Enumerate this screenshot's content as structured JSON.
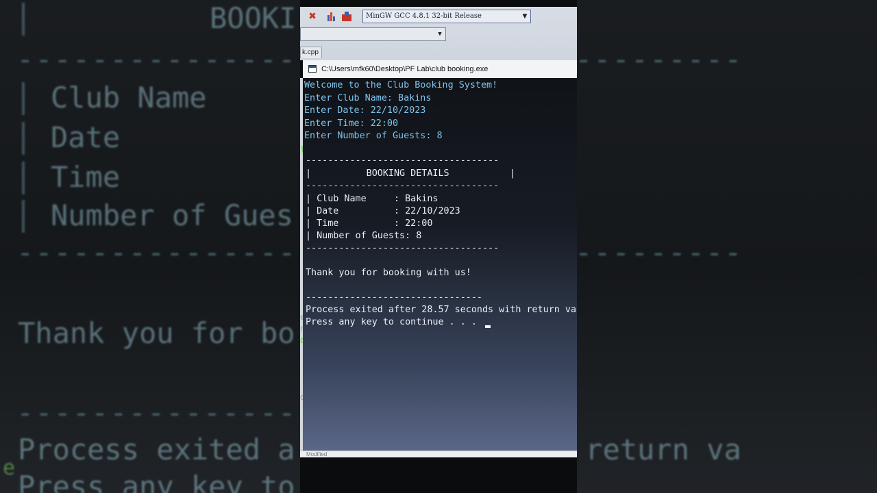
{
  "left_panel": {
    "title_fragment": "BOOKI",
    "lines": [
      "Club Name",
      "Date",
      "Time",
      "Number of Gues"
    ],
    "thanks_fragment": "Thank you for bo",
    "process_fragment": "Process exited a",
    "press_fragment": "Press any key to"
  },
  "right_panel": {
    "process_fragment": "ds with return va"
  },
  "ide": {
    "compiler": "MinGW GCC 4.8.1 32-bit Release",
    "file_tab": "k.cpp",
    "status": "Modified"
  },
  "console": {
    "window_title": "C:\\Users\\mfk60\\Desktop\\PF Lab\\club booking.exe",
    "welcome": "Welcome to the Club Booking System!",
    "prompt_club": "Enter Club Name: Bakins",
    "prompt_date": "Enter Date: 22/10/2023",
    "prompt_time": "Enter Time: 22:00",
    "prompt_guests": "Enter Number of Guests: 8",
    "divider": "-----------------------------------",
    "header": "|          BOOKING DETAILS           |",
    "row_club": "| Club Name     : Bakins",
    "row_date": "| Date          : 22/10/2023",
    "row_time": "| Time          : 22:00",
    "row_guests": "| Number of Guests: 8",
    "thanks": "Thank you for booking with us!",
    "short_divider": "--------------------------------",
    "process_exit": "Process exited after 28.57 seconds with return va",
    "press_key": "Press any key to continue . . ."
  }
}
